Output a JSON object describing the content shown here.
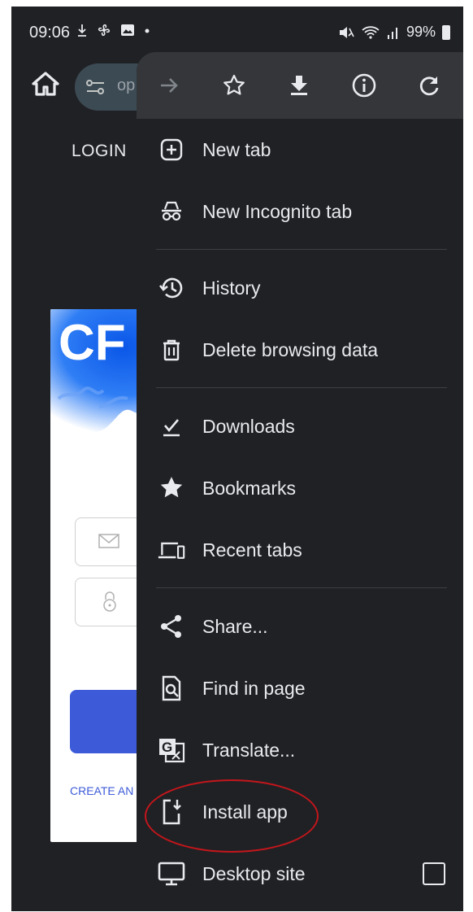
{
  "status_bar": {
    "time": "09:06",
    "battery": "99%"
  },
  "browser": {
    "url_fragment": "op"
  },
  "webpage": {
    "login_label": "LOGIN",
    "brand_mark": "CF",
    "create_account_link": "CREATE AN"
  },
  "menu": {
    "toolbar": [
      "forward-icon",
      "star-icon",
      "download-icon",
      "info-icon",
      "reload-icon"
    ],
    "items": [
      {
        "label": "New tab",
        "icon": "new-tab-icon"
      },
      {
        "label": "New Incognito tab",
        "icon": "incognito-icon"
      },
      {
        "label": "History",
        "icon": "history-icon"
      },
      {
        "label": "Delete browsing data",
        "icon": "trash-icon"
      },
      {
        "label": "Downloads",
        "icon": "downloads-icon"
      },
      {
        "label": "Bookmarks",
        "icon": "star-filled-icon"
      },
      {
        "label": "Recent tabs",
        "icon": "devices-icon"
      },
      {
        "label": "Share...",
        "icon": "share-icon"
      },
      {
        "label": "Find in page",
        "icon": "find-icon"
      },
      {
        "label": "Translate...",
        "icon": "translate-icon"
      },
      {
        "label": "Install app",
        "icon": "install-app-icon"
      },
      {
        "label": "Desktop site",
        "icon": "desktop-icon",
        "checkbox": false
      }
    ]
  },
  "colors": {
    "menu_bg": "#202124",
    "menu_toolbar_bg": "#343639",
    "text": "#e8eaed",
    "highlight_ring": "#c4161c",
    "card_button": "#3d5bd8"
  }
}
